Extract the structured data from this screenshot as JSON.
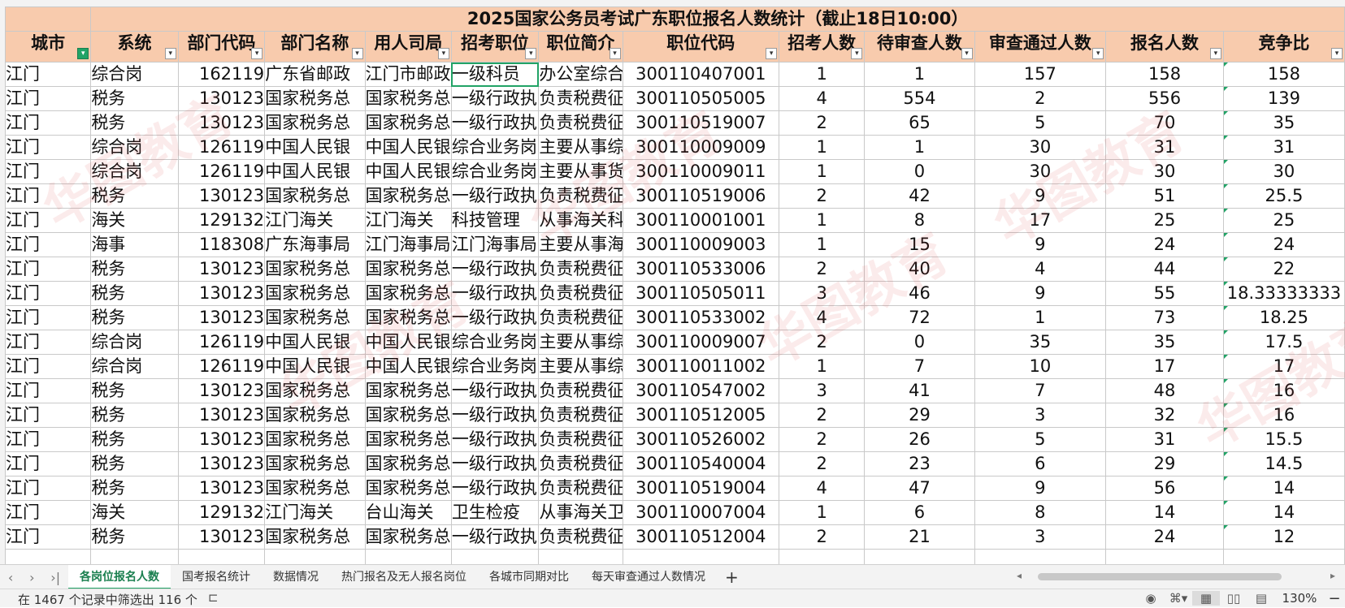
{
  "title": "2025国家公务员考试广东职位报名人数统计（截止18日10:00）",
  "columns": [
    {
      "label": "城市",
      "filter_active": true
    },
    {
      "label": "系统",
      "filter_active": false
    },
    {
      "label": "部门代码",
      "filter_active": false
    },
    {
      "label": "部门名称",
      "filter_active": false
    },
    {
      "label": "用人司局",
      "filter_active": false
    },
    {
      "label": "招考职位",
      "filter_active": false
    },
    {
      "label": "职位简介",
      "filter_active": false
    },
    {
      "label": "职位代码",
      "filter_active": false
    },
    {
      "label": "招考人数",
      "filter_active": false
    },
    {
      "label": "待审查人数",
      "filter_active": false
    },
    {
      "label": "审查通过人数",
      "filter_active": false
    },
    {
      "label": "报名人数",
      "filter_active": false
    },
    {
      "label": "竞争比",
      "filter_active": false
    }
  ],
  "rows": [
    [
      "江门",
      "综合岗",
      "162119",
      "广东省邮政",
      "江门市邮政",
      "一级科员",
      "办公室综合",
      "300110407001",
      "1",
      "1",
      "157",
      "158",
      "158"
    ],
    [
      "江门",
      "税务",
      "130123",
      "国家税务总",
      "国家税务总",
      "一级行政执",
      "负责税费征",
      "300110505005",
      "4",
      "554",
      "2",
      "556",
      "139"
    ],
    [
      "江门",
      "税务",
      "130123",
      "国家税务总",
      "国家税务总",
      "一级行政执",
      "负责税费征",
      "300110519007",
      "2",
      "65",
      "5",
      "70",
      "35"
    ],
    [
      "江门",
      "综合岗",
      "126119",
      "中国人民银",
      "中国人民银",
      "综合业务岗",
      "主要从事综",
      "300110009009",
      "1",
      "1",
      "30",
      "31",
      "31"
    ],
    [
      "江门",
      "综合岗",
      "126119",
      "中国人民银",
      "中国人民银",
      "综合业务岗",
      "主要从事货",
      "300110009011",
      "1",
      "0",
      "30",
      "30",
      "30"
    ],
    [
      "江门",
      "税务",
      "130123",
      "国家税务总",
      "国家税务总",
      "一级行政执",
      "负责税费征",
      "300110519006",
      "2",
      "42",
      "9",
      "51",
      "25.5"
    ],
    [
      "江门",
      "海关",
      "129132",
      "江门海关",
      "江门海关",
      "科技管理",
      "从事海关科",
      "300110001001",
      "1",
      "8",
      "17",
      "25",
      "25"
    ],
    [
      "江门",
      "海事",
      "118308",
      "广东海事局",
      "江门海事局",
      "江门海事局",
      "主要从事海",
      "300110009003",
      "1",
      "15",
      "9",
      "24",
      "24"
    ],
    [
      "江门",
      "税务",
      "130123",
      "国家税务总",
      "国家税务总",
      "一级行政执",
      "负责税费征",
      "300110533006",
      "2",
      "40",
      "4",
      "44",
      "22"
    ],
    [
      "江门",
      "税务",
      "130123",
      "国家税务总",
      "国家税务总",
      "一级行政执",
      "负责税费征",
      "300110505011",
      "3",
      "46",
      "9",
      "55",
      "18.33333333"
    ],
    [
      "江门",
      "税务",
      "130123",
      "国家税务总",
      "国家税务总",
      "一级行政执",
      "负责税费征",
      "300110533002",
      "4",
      "72",
      "1",
      "73",
      "18.25"
    ],
    [
      "江门",
      "综合岗",
      "126119",
      "中国人民银",
      "中国人民银",
      "综合业务岗",
      "主要从事综",
      "300110009007",
      "2",
      "0",
      "35",
      "35",
      "17.5"
    ],
    [
      "江门",
      "综合岗",
      "126119",
      "中国人民银",
      "中国人民银",
      "综合业务岗",
      "主要从事综",
      "300110011002",
      "1",
      "7",
      "10",
      "17",
      "17"
    ],
    [
      "江门",
      "税务",
      "130123",
      "国家税务总",
      "国家税务总",
      "一级行政执",
      "负责税费征",
      "300110547002",
      "3",
      "41",
      "7",
      "48",
      "16"
    ],
    [
      "江门",
      "税务",
      "130123",
      "国家税务总",
      "国家税务总",
      "一级行政执",
      "负责税费征",
      "300110512005",
      "2",
      "29",
      "3",
      "32",
      "16"
    ],
    [
      "江门",
      "税务",
      "130123",
      "国家税务总",
      "国家税务总",
      "一级行政执",
      "负责税费征",
      "300110526002",
      "2",
      "26",
      "5",
      "31",
      "15.5"
    ],
    [
      "江门",
      "税务",
      "130123",
      "国家税务总",
      "国家税务总",
      "一级行政执",
      "负责税费征",
      "300110540004",
      "2",
      "23",
      "6",
      "29",
      "14.5"
    ],
    [
      "江门",
      "税务",
      "130123",
      "国家税务总",
      "国家税务总",
      "一级行政执",
      "负责税费征",
      "300110519004",
      "4",
      "47",
      "9",
      "56",
      "14"
    ],
    [
      "江门",
      "海关",
      "129132",
      "江门海关",
      "台山海关",
      "卫生检疫",
      "从事海关卫",
      "300110007004",
      "1",
      "6",
      "8",
      "14",
      "14"
    ],
    [
      "江门",
      "税务",
      "130123",
      "国家税务总",
      "国家税务总",
      "一级行政执",
      "负责税费征",
      "300110512004",
      "2",
      "21",
      "3",
      "24",
      "12"
    ]
  ],
  "sheet_tabs": [
    {
      "label": "各岗位报名人数",
      "active": true
    },
    {
      "label": "国考报名统计",
      "active": false
    },
    {
      "label": "数据情况",
      "active": false
    },
    {
      "label": "热门报名及无人报名岗位",
      "active": false
    },
    {
      "label": "各城市同期对比",
      "active": false
    },
    {
      "label": "每天审查通过人数情况",
      "active": false
    }
  ],
  "add_tab_label": "+",
  "status": {
    "filter_text": "在 1467 个记录中筛选出 116 个",
    "zoom": "130%"
  },
  "icons": {
    "filter": "filter-dropdown-icon",
    "filter_active": "filter-applied-icon",
    "eye": "eye-icon",
    "normal_view": "normal-view-icon",
    "page_layout": "page-layout-icon",
    "page_break": "page-break-preview-icon"
  },
  "colors": {
    "header_fill": "#f8cbad",
    "accent": "#21a366"
  },
  "watermark_text": "华图教育"
}
